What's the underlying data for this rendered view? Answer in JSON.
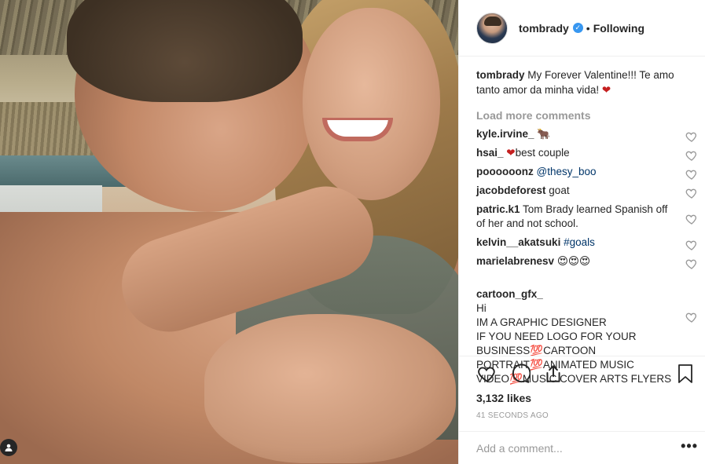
{
  "post": {
    "username": "tombrady",
    "follow_status": "Following",
    "caption": {
      "username": "tombrady",
      "text": "My Forever Valentine!!! Te amo tanto amor da minha vida!",
      "emoji": "❤"
    },
    "load_more": "Load more comments",
    "comments": [
      {
        "username": "kyle.irvine_",
        "text": "🐂",
        "mention": ""
      },
      {
        "username": "hsai_",
        "text": "best couple",
        "emoji": "❤",
        "mention": ""
      },
      {
        "username": "poooooonz",
        "text": "",
        "mention": "@thesy_boo"
      },
      {
        "username": "jacobdeforest",
        "text": "goat",
        "mention": ""
      },
      {
        "username": "patric.k1",
        "text": "Tom Brady learned Spanish off of her and not school.",
        "mention": ""
      },
      {
        "username": "kelvin__akatsuki",
        "text": "",
        "mention": "#goals"
      },
      {
        "username": "marielabrenesv",
        "text": "😍😍😍",
        "mention": ""
      },
      {
        "username": "cartoon_gfx_",
        "text": "Hi\nIM A GRAPHIC DESIGNER\nIF YOU NEED LOGO FOR YOUR BUSINESS💯CARTOON PORTRAIT💯ANIMATED MUSIC VIDEO💯MUSIC COVER ARTS FLYERS",
        "mention": ""
      }
    ],
    "likes": "3,132 likes",
    "timestamp": "41 SECONDS AGO",
    "add_comment_placeholder": "Add a comment...",
    "more_options": "•••"
  },
  "icons": {
    "verified": "verified-badge-icon",
    "like": "heart-outline-icon",
    "comment": "speech-bubble-icon",
    "share": "share-icon",
    "save": "bookmark-icon",
    "tag": "person-tag-icon"
  },
  "colors": {
    "verified": "#3897f0",
    "muted": "#999999",
    "heart": "#c52020",
    "mention": "#003569"
  }
}
